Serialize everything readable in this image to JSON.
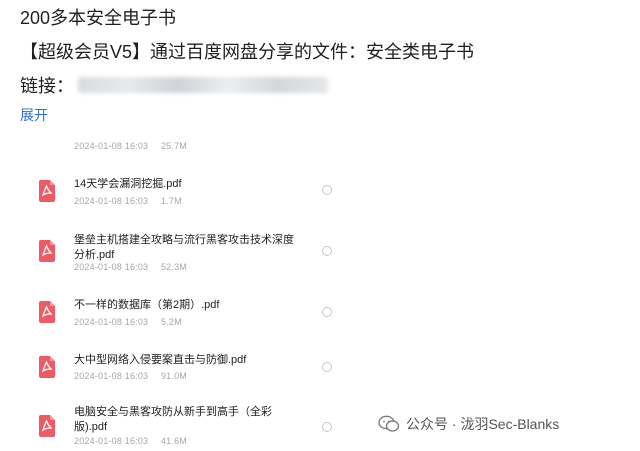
{
  "title": "200多本安全电子书",
  "description": "【超级会员V5】通过百度网盘分享的文件：安全类电子书",
  "link_label": "链接：",
  "expand_label": "展开",
  "top_meta": {
    "date": "2024-01-08 16:03",
    "size": "25.7M"
  },
  "files": [
    {
      "name": "14天学会漏洞挖掘.pdf",
      "date": "2024-01-08 16:03",
      "size": "1.7M"
    },
    {
      "name": "堡垒主机搭建全攻略与流行黑客攻击技术深度分析.pdf",
      "date": "2024-01-08 16:03",
      "size": "52.3M"
    },
    {
      "name": "不一样的数据库（第2期）.pdf",
      "date": "2024-01-08 16:03",
      "size": "5.2M"
    },
    {
      "name": "大中型网络入侵要案直击与防御.pdf",
      "date": "2024-01-08 16:03",
      "size": "91.0M"
    },
    {
      "name": "电脑安全与黑客攻防从新手到高手（全彩版).pdf",
      "date": "2024-01-08 16:03",
      "size": "41.6M"
    }
  ],
  "watermark": "公众号 · 泷羽Sec-Blanks",
  "colors": {
    "pdf_icon": "#ef5b64",
    "link": "#2f6fd0"
  }
}
